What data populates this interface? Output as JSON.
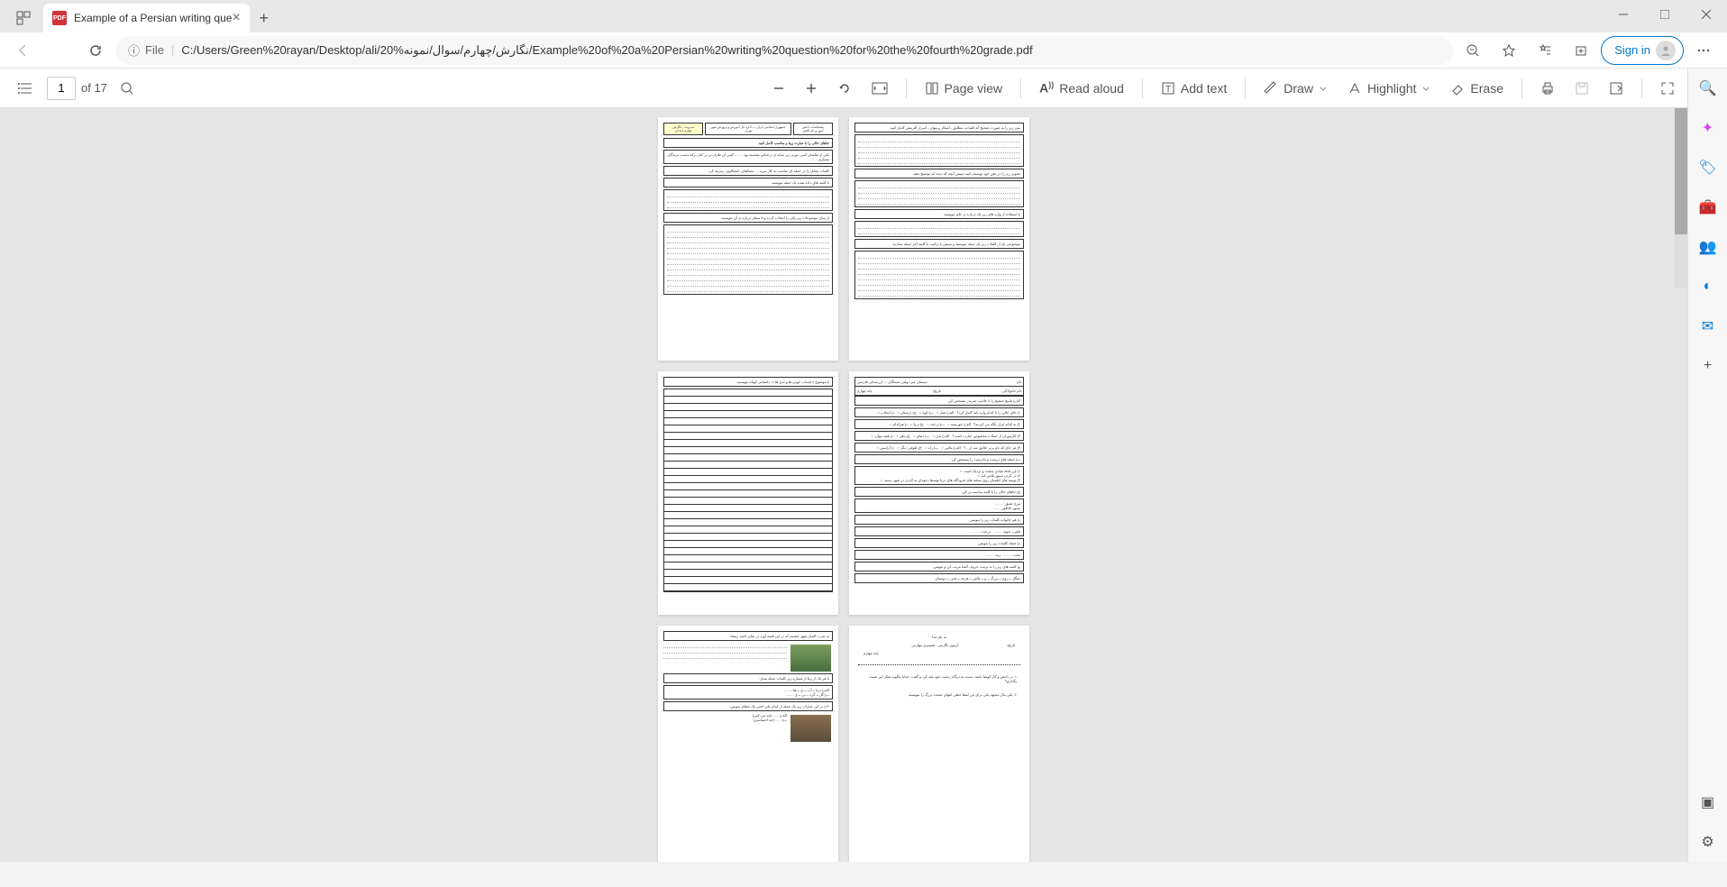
{
  "tab": {
    "title": "Example of a Persian writing que",
    "close": "×",
    "pdf_label": "PDF"
  },
  "address": {
    "protocol_label": "File",
    "info_icon": "ⓘ",
    "url": "C:/Users/Green%20rayan/Desktop/ali/نگارش/چهارم/سوال/نمونه%20/Example%20of%20a%20Persian%20writing%20question%20for%20the%20fourth%20grade.pdf",
    "signin": "Sign in"
  },
  "toolbar": {
    "page_current": "1",
    "page_total": "of 17",
    "page_view": "Page view",
    "read_aloud": "Read aloud",
    "add_text": "Add text",
    "draw": "Draw",
    "highlight": "Highlight",
    "erase": "Erase"
  },
  "side": {
    "search": "🔍",
    "plus": "✦",
    "tag": "🏷",
    "bag": "🧰",
    "people": "👥",
    "edge": "◐",
    "outlook": "✉",
    "add": "+",
    "collapse": "▣",
    "settings": "⚙"
  },
  "pages": {
    "p1_header": "جمهوری اسلامی ایران — اداره کل آموزش و پرورش شهر تهران",
    "p1_q1": "جاهای خالی را با عبارت زیبا و مناسب کامل کنید.",
    "p1_q2": "یکی از نقاشان کمی دورتر زیر سایه ی درختانی نشسته بود ........ کمی آن طرف تر در کنار برکه دست، پرندگان بسیاری ........",
    "p1_q3": "کلمات مقابل را در جمله ای مناسب به کار ببرید .... معتکفان، کنجکاوی، زمزمه کرد",
    "p1_q4": "با کلمه های داده شده یک جمله بنویسید",
    "p2_q1": "متن زیر را به صورت صحیح که کلمات، مطابق ـ آشکار و پنهان ـ اسرار آفرینش کامل کنید.",
    "p2_q2": "تصویر زیر را در ذهن خود توصیف کنید سپس آنچه که دیده اید توضیح دهید.",
    "p2_q3": "با استفاده از واژه های زیر یک درباره ی علم بنویسید",
    "p3_title": "با موضوع « اسباب خوبی ها و بدی ها »، داستانی کوتاه بنویسید.",
    "p4_header": "دبستان غیر دولتی سمنگان — ارزشیابی فارسی",
    "p4_name": "نام:",
    "p4_family": "نام خانوادگی:",
    "p4_date": "تاریخ:",
    "p4_q1": "الف) پاسخ صحیح را با علامت ضربدر مشخص کن.",
    "p4_q2": "ب) جمله های درست و نادرست را مشخص کن.",
    "p4_q3": "ج) جاهای خالی را با کلمه مناسب پر کن.",
    "p4_q4": "د) هم خانواده کلمات زیر را بنویس.",
    "p4_q5": "ه) جمله کلمات زیر را بنویس.",
    "p4_q6": "و) کلمه های زیر را به ترتیب حروف الفبا مرتب کن و بنویس.",
    "p5_q1": "به ضرب المثل شهر چشمه که در این قصه آورد در سایر احمد رستاد.",
    "p5_q2": "با هر یک از زیبا از شماره زیر کلمات جمله بساز.",
    "p6_header": "به نام خدا",
    "p6_sub": "آزمون نگارش - تفسیری مهارتی",
    "p6_date": "تاریخ:",
    "p6_class": "پایه چهارم"
  }
}
